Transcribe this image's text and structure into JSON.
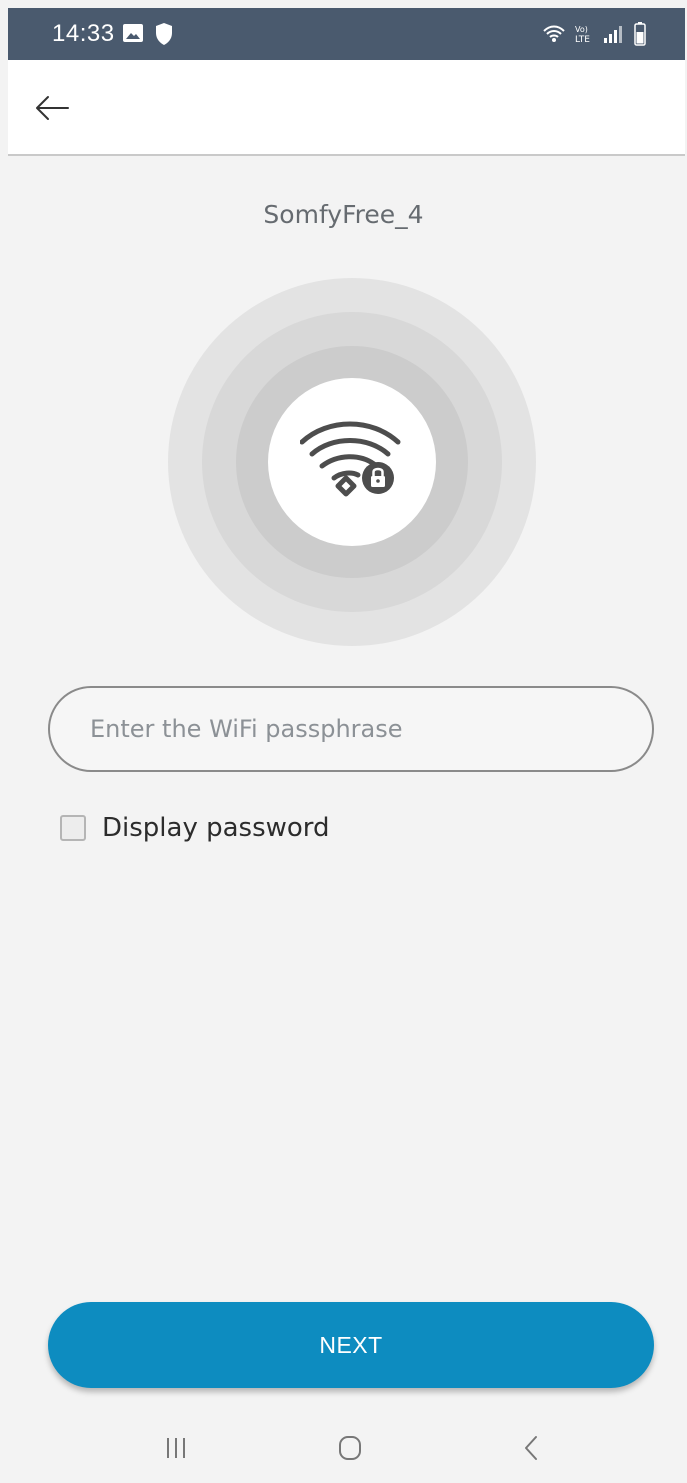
{
  "status_bar": {
    "time": "14:33",
    "left_icons": [
      "image-icon",
      "shield-icon"
    ],
    "right_icons": [
      "wifi-icon",
      "volte-icon",
      "signal-icon",
      "battery-icon"
    ],
    "color": "#4a5a6e"
  },
  "app_bar": {
    "back_icon": "arrow-left-icon"
  },
  "network": {
    "name": "SomfyFree_4",
    "icon": "wifi-lock-icon"
  },
  "password": {
    "placeholder": "Enter the WiFi passphrase",
    "value": ""
  },
  "display_password": {
    "label": "Display password",
    "checked": false
  },
  "next_button": {
    "label": "NEXT",
    "color": "#0d8cc0"
  },
  "nav_bar": {
    "icons": [
      "recent-apps-icon",
      "home-icon",
      "back-icon"
    ]
  }
}
